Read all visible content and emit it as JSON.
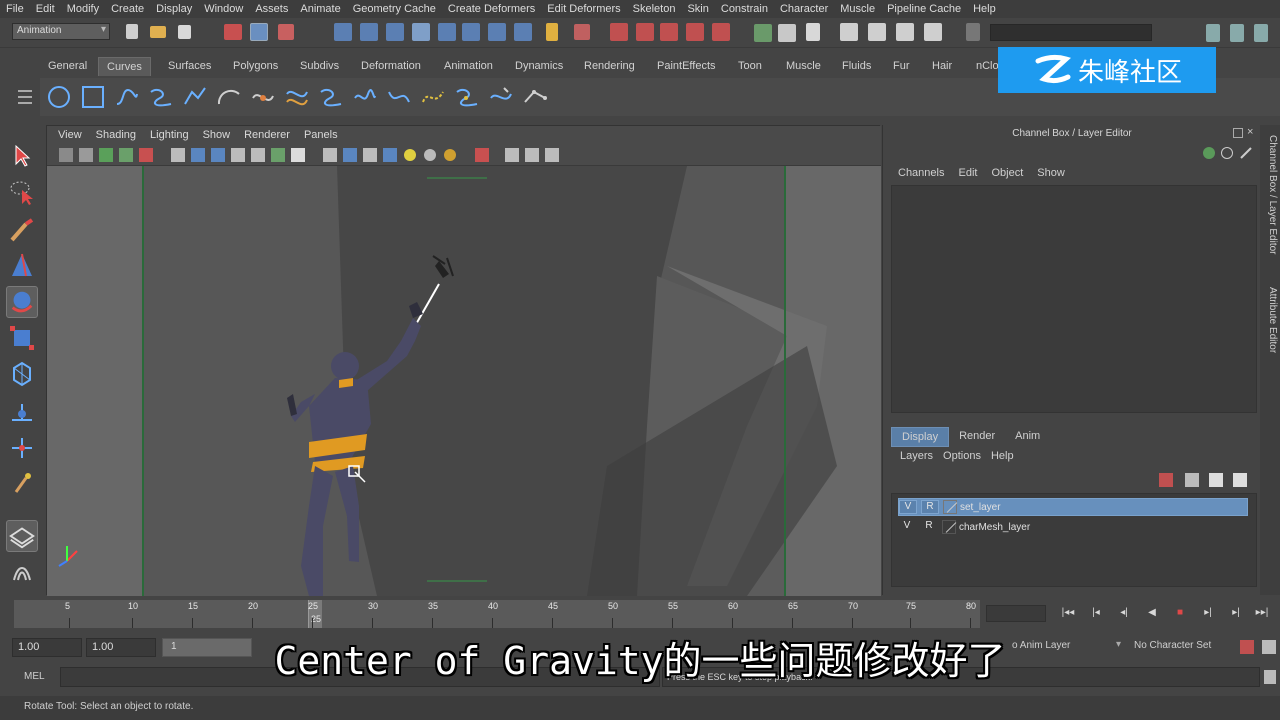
{
  "menubar": {
    "items": [
      "File",
      "Edit",
      "Modify",
      "Create",
      "Display",
      "Window",
      "Assets",
      "Animate",
      "Geometry Cache",
      "Create Deformers",
      "Edit Deformers",
      "Skeleton",
      "Skin",
      "Constrain",
      "Character",
      "Muscle",
      "Pipeline Cache",
      "Help"
    ]
  },
  "statusline": {
    "mode": "Animation"
  },
  "shelf": {
    "tabs": [
      "General",
      "Curves",
      "Surfaces",
      "Polygons",
      "Subdivs",
      "Deformation",
      "Animation",
      "Dynamics",
      "Rendering",
      "PaintEffects",
      "Toon",
      "Muscle",
      "Fluids",
      "Fur",
      "Hair",
      "nClo"
    ],
    "active_tab": "Curves"
  },
  "watermark": {
    "text": "朱峰社区"
  },
  "viewport": {
    "menu": [
      "View",
      "Shading",
      "Lighting",
      "Show",
      "Renderer",
      "Panels"
    ]
  },
  "channelbox": {
    "title": "Channel Box / Layer Editor",
    "menu": [
      "Channels",
      "Edit",
      "Object",
      "Show"
    ],
    "layer_tabs": [
      "Display",
      "Render",
      "Anim"
    ],
    "layer_menu": [
      "Layers",
      "Options",
      "Help"
    ],
    "layers": [
      {
        "v": "V",
        "r": "R",
        "name": "set_layer"
      },
      {
        "v": "V",
        "r": "R",
        "name": "charMesh_layer"
      }
    ],
    "side_tabs": [
      "Channel Box / Layer Editor",
      "Attribute Editor"
    ]
  },
  "timeslider": {
    "ticks": [
      "5",
      "10",
      "15",
      "20",
      "25",
      "30",
      "35",
      "40",
      "45",
      "50",
      "55",
      "60",
      "65",
      "70",
      "75",
      "80"
    ],
    "current_frame": "25"
  },
  "rangeslider": {
    "start": "1.00",
    "start2": "1.00",
    "range_label": "1",
    "anim_layer": "o Anim Layer",
    "char_set": "No Character Set"
  },
  "cmdline": {
    "label": "MEL",
    "feedback": "Press the ESC key to stop playback."
  },
  "helpline": {
    "text": "Rotate Tool: Select an object to rotate."
  },
  "subtitle": {
    "text": "Center of Gravity的一些问题修改好了"
  }
}
